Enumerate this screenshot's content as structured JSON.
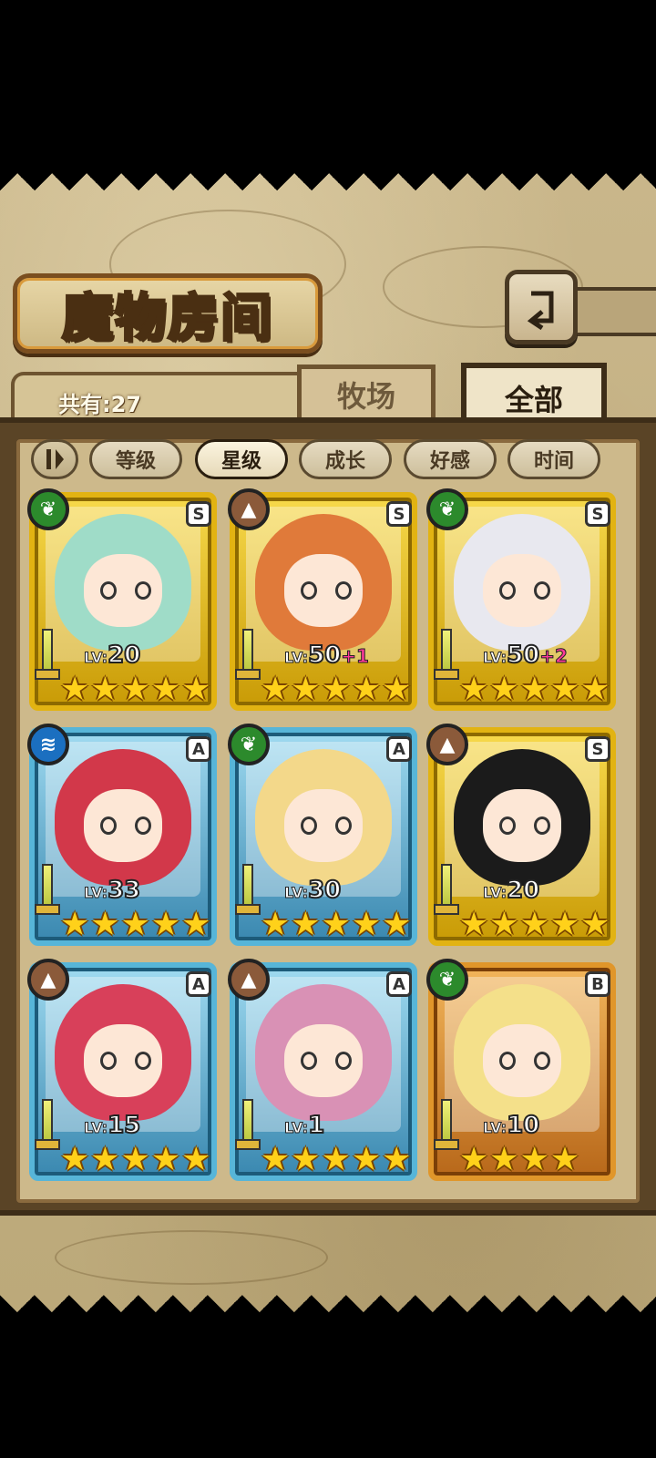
{
  "header": {
    "title": "魔物房间",
    "back_icon": "return-arrow-icon"
  },
  "summary": {
    "count_label": "共有:27"
  },
  "tabs": [
    {
      "label": "牧场",
      "active": false
    },
    {
      "label": "全部",
      "active": true
    }
  ],
  "sort": {
    "toggle_icon": "sort-direction-icon",
    "options": [
      {
        "label": "等级",
        "active": false
      },
      {
        "label": "星级",
        "active": true
      },
      {
        "label": "成长",
        "active": false
      },
      {
        "label": "好感",
        "active": false
      },
      {
        "label": "时间",
        "active": false
      }
    ]
  },
  "monsters": [
    {
      "frame": "gold",
      "element": "nature",
      "element_icon": "leaf-icon",
      "rank": "S",
      "lv_prefix": "LV:",
      "level": "20",
      "bonus": "",
      "stars": 5,
      "hair": "#9fdcc8"
    },
    {
      "frame": "gold",
      "element": "earth",
      "element_icon": "mountain-icon",
      "rank": "S",
      "lv_prefix": "LV:",
      "level": "50",
      "bonus": "+1",
      "stars": 5,
      "hair": "#e07a3a"
    },
    {
      "frame": "gold",
      "element": "nature",
      "element_icon": "leaf-icon",
      "rank": "S",
      "lv_prefix": "LV:",
      "level": "50",
      "bonus": "+2",
      "stars": 5,
      "hair": "#e8e8ef"
    },
    {
      "frame": "blue",
      "element": "water",
      "element_icon": "water-icon",
      "rank": "A",
      "lv_prefix": "LV:",
      "level": "33",
      "bonus": "",
      "stars": 5,
      "hair": "#d2384a"
    },
    {
      "frame": "blue",
      "element": "nature",
      "element_icon": "leaf-icon",
      "rank": "A",
      "lv_prefix": "LV:",
      "level": "30",
      "bonus": "",
      "stars": 5,
      "hair": "#f3d88a"
    },
    {
      "frame": "gold",
      "element": "earth",
      "element_icon": "mountain-icon",
      "rank": "S",
      "lv_prefix": "LV:",
      "level": "20",
      "bonus": "",
      "stars": 5,
      "hair": "#1b1b1b"
    },
    {
      "frame": "blue",
      "element": "earth",
      "element_icon": "mountain-icon",
      "rank": "A",
      "lv_prefix": "LV:",
      "level": "15",
      "bonus": "",
      "stars": 5,
      "hair": "#d8405a"
    },
    {
      "frame": "blue",
      "element": "earth",
      "element_icon": "mountain-icon",
      "rank": "A",
      "lv_prefix": "LV:",
      "level": "1",
      "bonus": "",
      "stars": 5,
      "hair": "#d991b5"
    },
    {
      "frame": "bronze",
      "element": "nature",
      "element_icon": "leaf-icon",
      "rank": "B",
      "lv_prefix": "LV:",
      "level": "10",
      "bonus": "",
      "stars": 4,
      "hair": "#f4e08a"
    }
  ]
}
